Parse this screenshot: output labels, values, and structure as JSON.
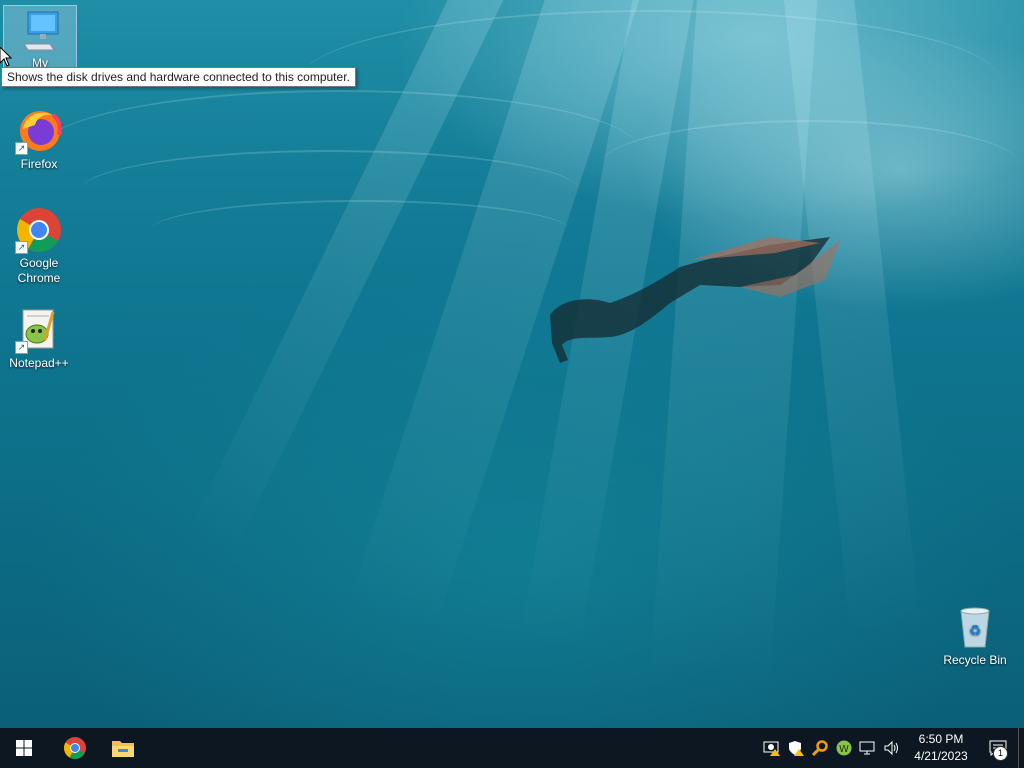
{
  "desktop": {
    "icons": [
      {
        "label": "My Computer",
        "icon": "computer-icon"
      },
      {
        "label": "Firefox",
        "icon": "firefox-icon"
      },
      {
        "label": "Google Chrome",
        "icon": "chrome-icon"
      },
      {
        "label": "Notepad++",
        "icon": "notepadpp-icon"
      },
      {
        "label": "Recycle Bin",
        "icon": "recycle-bin-icon"
      }
    ],
    "tooltip": "Shows the disk drives and hardware connected to this computer."
  },
  "taskbar": {
    "pinned": [
      "start-icon",
      "chrome-icon",
      "file-explorer-icon"
    ],
    "tray_icons": [
      "network-warning-icon",
      "security-warning-icon",
      "search-tool-icon",
      "w-app-icon",
      "network-icon",
      "volume-icon"
    ],
    "clock": {
      "time": "6:50 PM",
      "date": "4/21/2023"
    },
    "notifications": {
      "count": "1"
    }
  },
  "colors": {
    "taskbar": "#0c1722",
    "wallpaper": "#0f7590"
  }
}
